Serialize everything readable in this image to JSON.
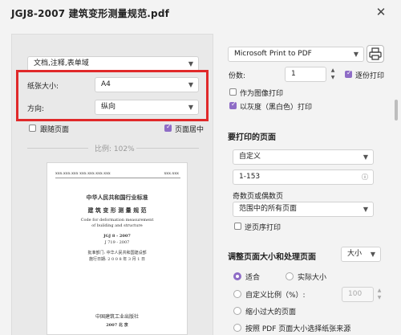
{
  "window": {
    "title": "JGJ8-2007 建筑变形测量规范.pdf"
  },
  "left": {
    "content_select": "文档,注释,表单域",
    "paper_size_label": "纸张大小:",
    "paper_size_value": "A4",
    "orientation_label": "方向:",
    "orientation_value": "纵向",
    "reverse_label": "跟随页面",
    "center_label": "页面居中",
    "scale_text": "比例: 102%"
  },
  "preview": {
    "header_left": "xxx.xxx.xxx  xxx.xxx.xxx.xxx",
    "header_right": "xxx.xxx",
    "title1": "中华人民共和国行业标准",
    "title2": "建 筑 变 形 测 量 规 范",
    "title3": "Code for deformation measurement",
    "title4": "of building and structure",
    "code1": "JGJ 8 - 2007",
    "code2": "J 719 - 2007",
    "approve1": "批准部门: 中华人民共和国建设部",
    "approve2": "施行日期: 2 0 0 8 年 3 月 1 日",
    "pub1": "中国建筑工业出版社",
    "pub2": "2007  北 京"
  },
  "right": {
    "printer_value": "Microsoft Print to PDF",
    "copies_label": "份数:",
    "copies_value": "1",
    "collate_label": "逐份打印",
    "as_image_label": "作为图像打印",
    "grayscale_label": "以灰度（黑白色）打印",
    "pages_heading": "要打印的页面",
    "pages_select": "自定义",
    "pages_range": "1-153",
    "odd_even_label": "奇数页或偶数页",
    "odd_even_select": "范围中的所有页面",
    "reverse_order_label": "逆页序打印",
    "resize_heading": "调整页面大小和处理页面",
    "size_button": "大小",
    "fit_label": "适合",
    "actual_label": "实际大小",
    "custom_scale_label": "自定义比例（%）:",
    "custom_scale_value": "100",
    "shrink_label": "缩小过大的页面",
    "pdf_source_label": "按照 PDF 页面大小选择纸张来源"
  }
}
